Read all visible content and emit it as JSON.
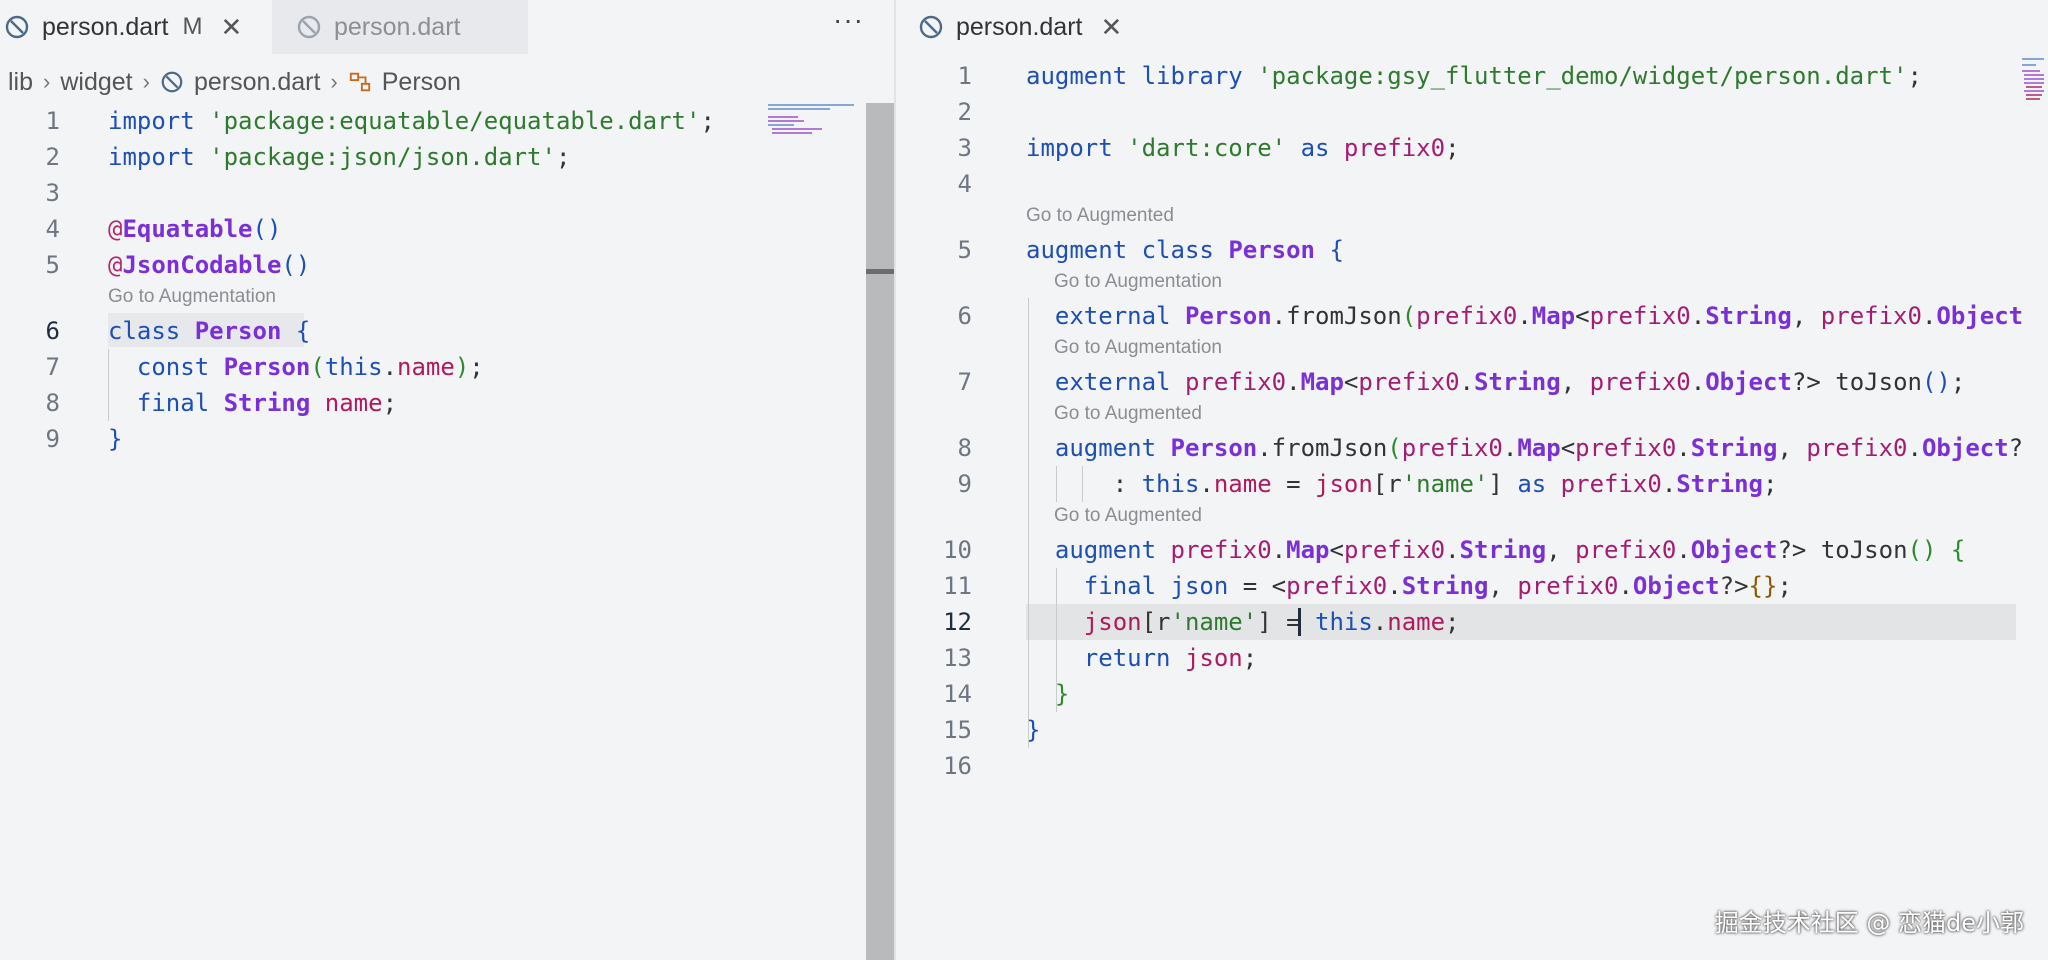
{
  "left_editor": {
    "tabs": [
      {
        "label": "person.dart",
        "modified": "M",
        "active": true
      },
      {
        "label": "person.dart",
        "active": false
      }
    ],
    "more_label": "···",
    "breadcrumb": [
      "lib",
      "widget",
      "person.dart",
      "Person"
    ],
    "codelens": "Go to Augmentation",
    "lines": [
      {
        "n": "1",
        "tokens": [
          [
            "kw",
            "import"
          ],
          [
            "pn",
            " "
          ],
          [
            "str",
            "'package:equatable/equatable.dart'"
          ],
          [
            "pn",
            ";"
          ]
        ]
      },
      {
        "n": "2",
        "tokens": [
          [
            "kw",
            "import"
          ],
          [
            "pn",
            " "
          ],
          [
            "str",
            "'package:json/json.dart'"
          ],
          [
            "pn",
            ";"
          ]
        ]
      },
      {
        "n": "3",
        "tokens": []
      },
      {
        "n": "4",
        "tokens": [
          [
            "ann",
            "@"
          ],
          [
            "cls",
            "Equatable"
          ],
          [
            "br",
            "()"
          ]
        ]
      },
      {
        "n": "5",
        "tokens": [
          [
            "ann",
            "@"
          ],
          [
            "cls",
            "JsonCodable"
          ],
          [
            "br",
            "()"
          ]
        ]
      },
      {
        "n": "6",
        "tokens": [
          [
            "kw",
            "class"
          ],
          [
            "pn",
            " "
          ],
          [
            "cls",
            "Person"
          ],
          [
            "pn",
            " "
          ],
          [
            "br",
            "{"
          ]
        ]
      },
      {
        "n": "7",
        "tokens": [
          [
            "pn",
            "  "
          ],
          [
            "kw",
            "const"
          ],
          [
            "pn",
            " "
          ],
          [
            "cls",
            "Person"
          ],
          [
            "par",
            "("
          ],
          [
            "kw",
            "this"
          ],
          [
            "pn",
            "."
          ],
          [
            "prop",
            "name"
          ],
          [
            "par",
            ")"
          ],
          [
            "pn",
            ";"
          ]
        ]
      },
      {
        "n": "8",
        "tokens": [
          [
            "pn",
            "  "
          ],
          [
            "kw",
            "final"
          ],
          [
            "pn",
            " "
          ],
          [
            "cls",
            "String"
          ],
          [
            "pn",
            " "
          ],
          [
            "prop",
            "name"
          ],
          [
            "pn",
            ";"
          ]
        ]
      },
      {
        "n": "9",
        "tokens": [
          [
            "br",
            "}"
          ]
        ]
      }
    ]
  },
  "right_editor": {
    "tab": {
      "label": "person.dart",
      "active": true
    },
    "codelens": {
      "augmented": "Go to Augmented",
      "augmentation": "Go to Augmentation"
    },
    "lines": [
      {
        "n": "1",
        "tokens": [
          [
            "kw",
            "augment"
          ],
          [
            "pn",
            " "
          ],
          [
            "kw",
            "library"
          ],
          [
            "pn",
            " "
          ],
          [
            "str",
            "'package:gsy_flutter_demo/widget/person.dart'"
          ],
          [
            "pn",
            ";"
          ]
        ]
      },
      {
        "n": "2",
        "tokens": []
      },
      {
        "n": "3",
        "tokens": [
          [
            "kw",
            "import"
          ],
          [
            "pn",
            " "
          ],
          [
            "str",
            "'dart:core'"
          ],
          [
            "pn",
            " "
          ],
          [
            "kw",
            "as"
          ],
          [
            "pn",
            " "
          ],
          [
            "pref",
            "prefix0"
          ],
          [
            "pn",
            ";"
          ]
        ]
      },
      {
        "n": "4",
        "tokens": []
      },
      {
        "n": "5",
        "tokens": [
          [
            "kw",
            "augment"
          ],
          [
            "pn",
            " "
          ],
          [
            "kw",
            "class"
          ],
          [
            "pn",
            " "
          ],
          [
            "cls",
            "Person"
          ],
          [
            "pn",
            " "
          ],
          [
            "br",
            "{"
          ]
        ]
      },
      {
        "n": "6",
        "tokens": [
          [
            "pn",
            "  "
          ],
          [
            "kw",
            "external"
          ],
          [
            "pn",
            " "
          ],
          [
            "cls",
            "Person"
          ],
          [
            "pn",
            "."
          ],
          [
            "fn",
            "fromJson"
          ],
          [
            "par",
            "("
          ],
          [
            "pref",
            "prefix0"
          ],
          [
            "pn",
            "."
          ],
          [
            "cls",
            "Map"
          ],
          [
            "pn",
            "<"
          ],
          [
            "pref",
            "prefix0"
          ],
          [
            "pn",
            "."
          ],
          [
            "cls",
            "String"
          ],
          [
            "pn",
            ", "
          ],
          [
            "pref",
            "prefix0"
          ],
          [
            "pn",
            "."
          ],
          [
            "cls",
            "Object"
          ]
        ]
      },
      {
        "n": "7",
        "tokens": [
          [
            "pn",
            "  "
          ],
          [
            "kw",
            "external"
          ],
          [
            "pn",
            " "
          ],
          [
            "pref",
            "prefix0"
          ],
          [
            "pn",
            "."
          ],
          [
            "cls",
            "Map"
          ],
          [
            "pn",
            "<"
          ],
          [
            "pref",
            "prefix0"
          ],
          [
            "pn",
            "."
          ],
          [
            "cls",
            "String"
          ],
          [
            "pn",
            ", "
          ],
          [
            "pref",
            "prefix0"
          ],
          [
            "pn",
            "."
          ],
          [
            "cls",
            "Object"
          ],
          [
            "pn",
            "?> "
          ],
          [
            "fn",
            "toJson"
          ],
          [
            "br",
            "()"
          ],
          [
            "pn",
            ";"
          ]
        ]
      },
      {
        "n": "8",
        "tokens": [
          [
            "pn",
            "  "
          ],
          [
            "kw",
            "augment"
          ],
          [
            "pn",
            " "
          ],
          [
            "cls",
            "Person"
          ],
          [
            "pn",
            "."
          ],
          [
            "fn",
            "fromJson"
          ],
          [
            "par",
            "("
          ],
          [
            "pref",
            "prefix0"
          ],
          [
            "pn",
            "."
          ],
          [
            "cls",
            "Map"
          ],
          [
            "pn",
            "<"
          ],
          [
            "pref",
            "prefix0"
          ],
          [
            "pn",
            "."
          ],
          [
            "cls",
            "String"
          ],
          [
            "pn",
            ", "
          ],
          [
            "pref",
            "prefix0"
          ],
          [
            "pn",
            "."
          ],
          [
            "cls",
            "Object"
          ],
          [
            "pn",
            "?"
          ]
        ]
      },
      {
        "n": "9",
        "tokens": [
          [
            "pn",
            "      : "
          ],
          [
            "kw",
            "this"
          ],
          [
            "pn",
            "."
          ],
          [
            "prop",
            "name"
          ],
          [
            "pn",
            " = "
          ],
          [
            "prop",
            "json"
          ],
          [
            "pn",
            "[r"
          ],
          [
            "str",
            "'name'"
          ],
          [
            "pn",
            "] "
          ],
          [
            "kw",
            "as"
          ],
          [
            "pn",
            " "
          ],
          [
            "pref",
            "prefix0"
          ],
          [
            "pn",
            "."
          ],
          [
            "cls",
            "String"
          ],
          [
            "pn",
            ";"
          ]
        ]
      },
      {
        "n": "10",
        "tokens": [
          [
            "pn",
            "  "
          ],
          [
            "kw",
            "augment"
          ],
          [
            "pn",
            " "
          ],
          [
            "pref",
            "prefix0"
          ],
          [
            "pn",
            "."
          ],
          [
            "cls",
            "Map"
          ],
          [
            "pn",
            "<"
          ],
          [
            "pref",
            "prefix0"
          ],
          [
            "pn",
            "."
          ],
          [
            "cls",
            "String"
          ],
          [
            "pn",
            ", "
          ],
          [
            "pref",
            "prefix0"
          ],
          [
            "pn",
            "."
          ],
          [
            "cls",
            "Object"
          ],
          [
            "pn",
            "?> "
          ],
          [
            "fn",
            "toJson"
          ],
          [
            "par",
            "()"
          ],
          [
            "pn",
            " "
          ],
          [
            "par",
            "{"
          ]
        ]
      },
      {
        "n": "11",
        "tokens": [
          [
            "pn",
            "    "
          ],
          [
            "kw",
            "final"
          ],
          [
            "pn",
            " "
          ],
          [
            "kw",
            "json"
          ],
          [
            "pn",
            " = <"
          ],
          [
            "pref",
            "prefix0"
          ],
          [
            "pn",
            "."
          ],
          [
            "cls",
            "String"
          ],
          [
            "pn",
            ", "
          ],
          [
            "pref",
            "prefix0"
          ],
          [
            "pn",
            "."
          ],
          [
            "cls",
            "Object"
          ],
          [
            "pn",
            "?>"
          ],
          [
            "gen",
            "{}"
          ],
          [
            "pn",
            ";"
          ]
        ]
      },
      {
        "n": "12",
        "tokens": [
          [
            "pn",
            "    "
          ],
          [
            "prop",
            "json"
          ],
          [
            "pn",
            "[r"
          ],
          [
            "str",
            "'name'"
          ],
          [
            "pn",
            "] = "
          ],
          [
            "kw",
            "this"
          ],
          [
            "pn",
            "."
          ],
          [
            "prop",
            "name"
          ],
          [
            "pn",
            ";"
          ]
        ]
      },
      {
        "n": "13",
        "tokens": [
          [
            "pn",
            "    "
          ],
          [
            "kw",
            "return"
          ],
          [
            "pn",
            " "
          ],
          [
            "prop",
            "json"
          ],
          [
            "pn",
            ";"
          ]
        ]
      },
      {
        "n": "14",
        "tokens": [
          [
            "pn",
            "  "
          ],
          [
            "par",
            "}"
          ]
        ]
      },
      {
        "n": "15",
        "tokens": [
          [
            "br",
            "}"
          ]
        ]
      },
      {
        "n": "16",
        "tokens": []
      }
    ]
  },
  "watermark": "掘金技术社区 @ 恋猫de小郭",
  "colors": {
    "keyword": "#1d4fb5",
    "class": "#7b2fd6",
    "string": "#2f7a2f",
    "background": "#f3f4f6"
  }
}
